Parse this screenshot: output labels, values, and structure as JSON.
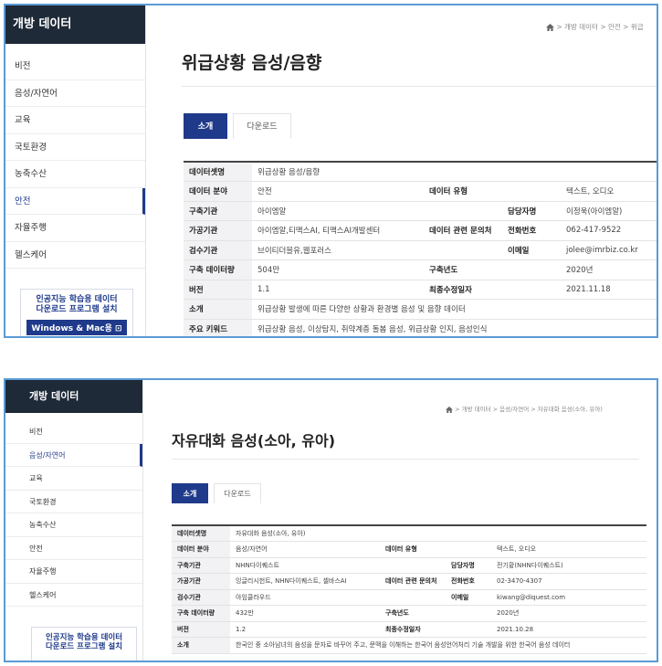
{
  "screens": [
    {
      "sidebar": {
        "header": "개방 데이터",
        "items": [
          "비전",
          "음성/자연어",
          "교육",
          "국토환경",
          "농축수산",
          "안전",
          "자율주행",
          "헬스케어"
        ],
        "active_index": 5,
        "download_box": {
          "line1": "인공지능 학습용 데이터",
          "line2": "다운로드 프로그램 설치",
          "button": "Windows & Mac용 ⊡"
        }
      },
      "breadcrumb": "> 개방 데이터 > 안전 > 위급",
      "title": "위급상황 음성/음향",
      "tabs": [
        "소개",
        "다운로드"
      ],
      "table": {
        "dataset_label": "데이터셋명",
        "dataset_value": "위급상황 음성/음향",
        "field_label": "데이터 분야",
        "field_value": "안전",
        "type_label": "데이터 유형",
        "type_value": "텍스트, 오디오",
        "builder_label": "구축기관",
        "builder_value": "아이엠알",
        "manager_label": "담당자명",
        "manager_value": "이정욱(아이엠알)",
        "processor_label": "가공기관",
        "processor_value": "아이엠알,티맥스AI, 티맥스AI개발센터",
        "inquiry_label": "데이터 관련 문의처",
        "phone_label": "전화번호",
        "phone_value": "062-417-9522",
        "inspector_label": "검수기관",
        "inspector_value": "브이티더블유,웹포러스",
        "email_label": "이메일",
        "email_value": "jolee@imrbiz.co.kr",
        "amount_label": "구축 데이터량",
        "amount_value": "504만",
        "year_label": "구축년도",
        "year_value": "2020년",
        "version_label": "버전",
        "version_value": "1.1",
        "modified_label": "최종수정일자",
        "modified_value": "2021.11.18",
        "intro_label": "소개",
        "intro_value": "위급상황 발생에 따른 다양한 상황과 환경별 음성 및 음향 데이터",
        "keyword_label": "주요 키워드",
        "keyword_value": "위급상황 음성, 이상탐지, 취약계층 돌봄 음성, 위급상황 인지, 음성인식"
      }
    },
    {
      "sidebar": {
        "header": "개방 데이터",
        "items": [
          "비전",
          "음성/자연어",
          "교육",
          "국토환경",
          "농축수산",
          "안전",
          "자율주행",
          "헬스케어"
        ],
        "active_index": 1,
        "download_box": {
          "line1": "인공지능 학습용 데이터",
          "line2": "다운로드 프로그램 설치",
          "button": ""
        }
      },
      "breadcrumb": "> 개방 데이터 > 음성/자연어 > 자유대화 음성(소아, 유아)",
      "title": "자유대화 음성(소아, 유아)",
      "tabs": [
        "소개",
        "다운로드"
      ],
      "table": {
        "dataset_label": "데이터셋명",
        "dataset_value": "자유대화 음성(소아, 유아)",
        "field_label": "데이터 분야",
        "field_value": "음성/자연어",
        "type_label": "데이터 유형",
        "type_value": "텍스트, 오디오",
        "builder_label": "구축기관",
        "builder_value": "NHN다이퀘스트",
        "manager_label": "담당자명",
        "manager_value": "전기황(NHN다이퀘스트)",
        "processor_label": "가공기관",
        "processor_value": "잉글리시헌트, NHN다이퀘스트, 셀바스AI",
        "inquiry_label": "데이터 관련 문의처",
        "phone_label": "전화번호",
        "phone_value": "02-3470-4307",
        "inspector_label": "검수기관",
        "inspector_value": "아임클라우드",
        "email_label": "이메일",
        "email_value": "kiwang@diquest.com",
        "amount_label": "구축 데이터량",
        "amount_value": "432만",
        "year_label": "구축년도",
        "year_value": "2020년",
        "version_label": "버전",
        "version_value": "1.2",
        "modified_label": "최종수정일자",
        "modified_value": "2021.10.28",
        "intro_label": "소개",
        "intro_value": "한국인 중 소아남녀의 음성을 문자로 바꾸어 주고, 문맥을 이해하는 한국어 음성언어처리 기술 개발을 위한 한국어 음성 데이터",
        "keyword_label": "",
        "keyword_value": ""
      }
    }
  ]
}
